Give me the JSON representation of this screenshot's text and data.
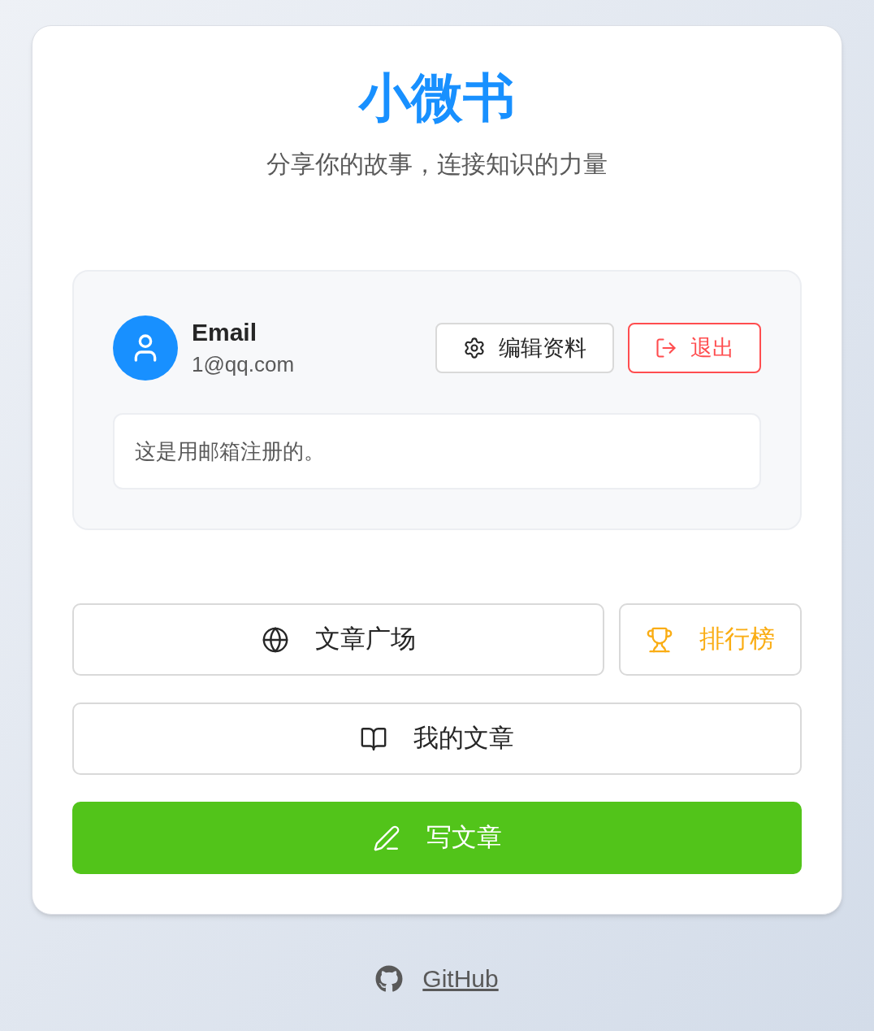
{
  "app": {
    "title": "小微书",
    "subtitle": "分享你的故事，连接知识的力量"
  },
  "profile": {
    "name": "Email",
    "email": "1@qq.com",
    "bio": "这是用邮箱注册的。",
    "actions": [
      {
        "kind": "edit",
        "label": "编辑资料"
      },
      {
        "kind": "logout",
        "label": "退出"
      }
    ]
  },
  "nav": [
    [
      {
        "kind": "square",
        "label": "文章广场"
      },
      {
        "kind": "ranking",
        "label": "排行榜"
      }
    ],
    [
      {
        "kind": "mine",
        "label": "我的文章"
      }
    ],
    [
      {
        "kind": "write",
        "label": "写文章"
      }
    ]
  ],
  "footer": {
    "link": "GitHub"
  }
}
